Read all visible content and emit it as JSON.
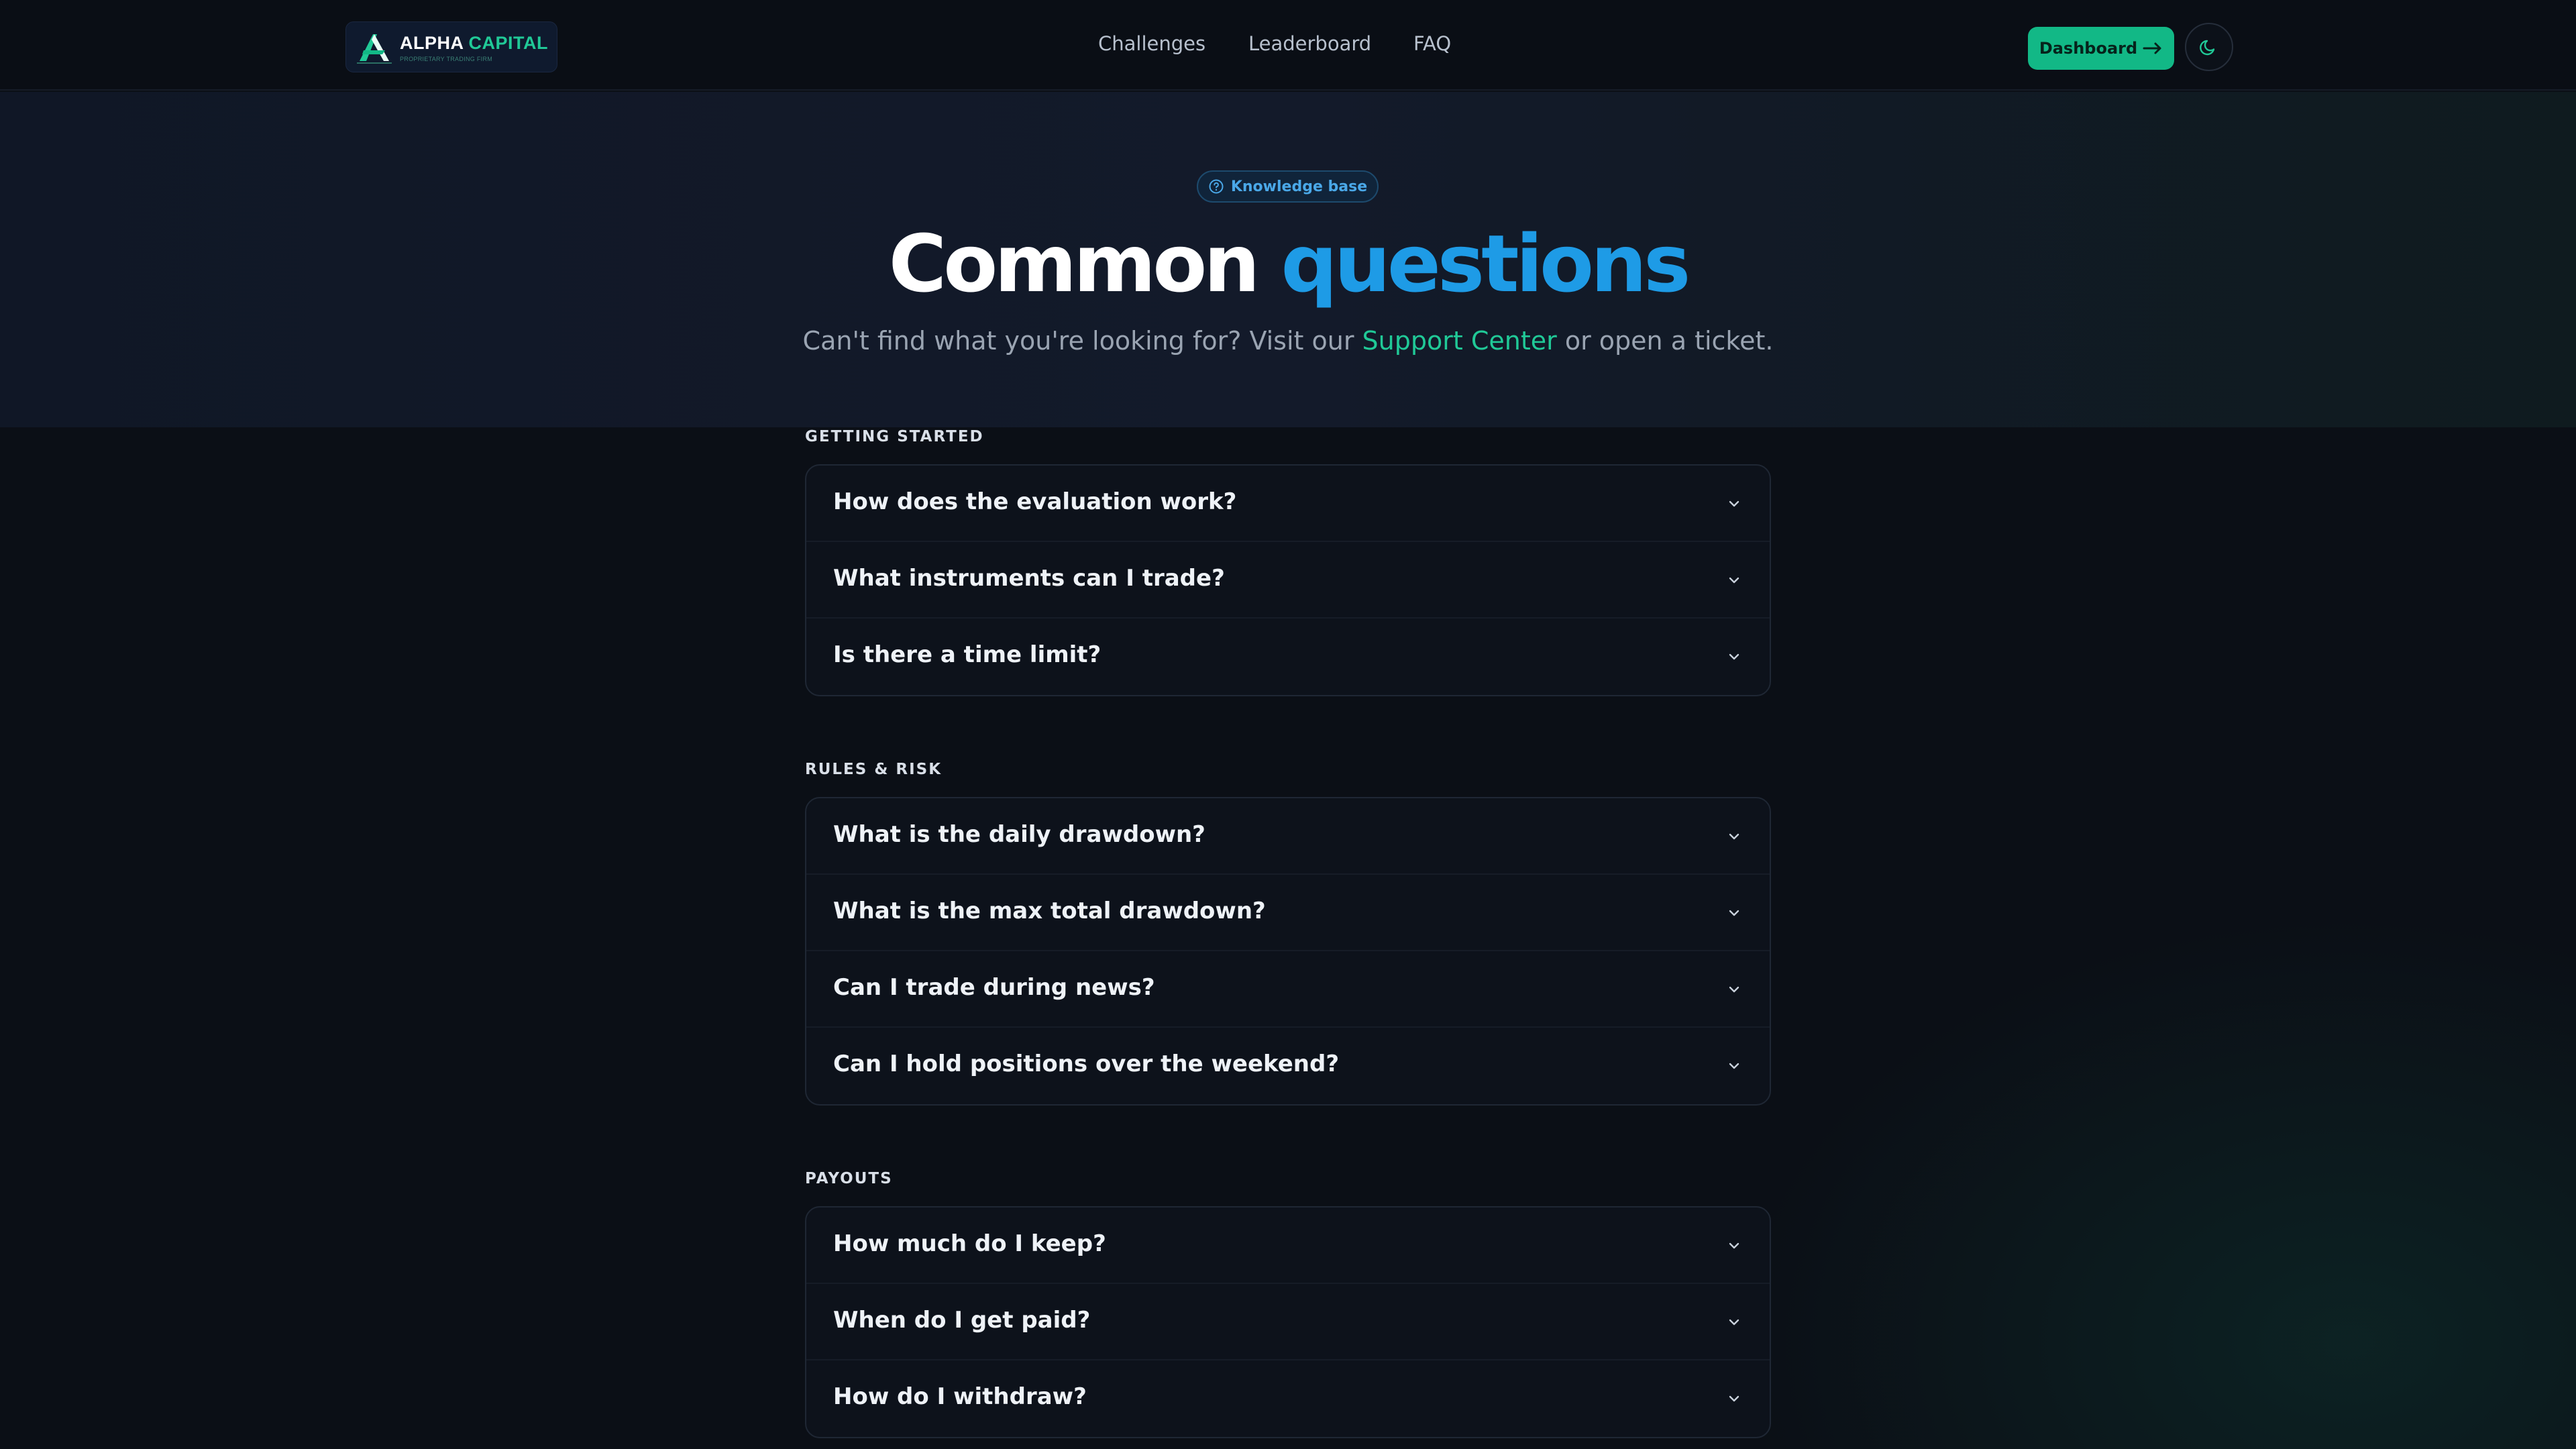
{
  "nav": {
    "logo": {
      "name_part1": "ALPHA",
      "name_part2": "CAPITAL",
      "tagline": "PROPRIETARY TRADING FIRM",
      "icon": "alpha-logo-mark"
    },
    "links": [
      {
        "label": "Challenges"
      },
      {
        "label": "Leaderboard"
      },
      {
        "label": "FAQ"
      }
    ],
    "dashboard_button": {
      "label": "Dashboard",
      "icon": "arrow-right-icon"
    },
    "theme_toggle": {
      "icon": "moon-icon"
    }
  },
  "hero": {
    "badge": {
      "label": "Knowledge base",
      "icon": "question-circle-icon"
    },
    "title_part1": "Common",
    "title_part2": "questions",
    "subtitle_before": "Can't find what you're looking for? Visit our",
    "subtitle_link": "Support Center",
    "subtitle_after": "or open a ticket."
  },
  "faq": {
    "sections": [
      {
        "label": "GETTING STARTED",
        "items": [
          {
            "question": "How does the evaluation work?"
          },
          {
            "question": "What instruments can I trade?"
          },
          {
            "question": "Is there a time limit?"
          }
        ]
      },
      {
        "label": "RULES & RISK",
        "items": [
          {
            "question": "What is the daily drawdown?"
          },
          {
            "question": "What is the max total drawdown?"
          },
          {
            "question": "Can I trade during news?"
          },
          {
            "question": "Can I hold positions over the weekend?"
          }
        ]
      },
      {
        "label": "PAYOUTS",
        "items": [
          {
            "question": "How much do I keep?"
          },
          {
            "question": "When do I get paid?"
          },
          {
            "question": "How do I withdraw?"
          }
        ]
      }
    ]
  },
  "colors": {
    "accent_green": "#12b886",
    "accent_blue": "#1e9be6",
    "background": "#0b0f16"
  }
}
